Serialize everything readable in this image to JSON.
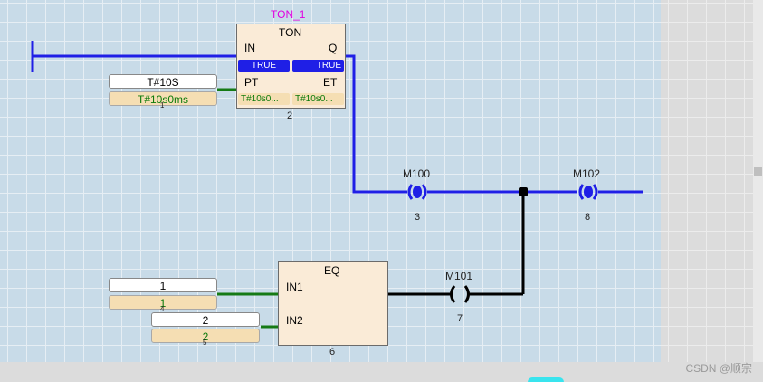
{
  "ton_block": {
    "instance_name": "TON_1",
    "type": "TON",
    "in_label": "IN",
    "q_label": "Q",
    "pt_label": "PT",
    "et_label": "ET",
    "in_value": "TRUE",
    "q_value": "TRUE",
    "pt_value": "T#10s0...",
    "et_value": "T#10s0...",
    "number": "2"
  },
  "ton_pt_input": {
    "constant": "T#10S",
    "live_value": "T#10s0ms",
    "number": "1"
  },
  "eq_block": {
    "type": "EQ",
    "in1_label": "IN1",
    "in2_label": "IN2",
    "number": "6"
  },
  "eq_in1_input": {
    "constant": "1",
    "live_value": "1",
    "number": "4"
  },
  "eq_in2_input": {
    "constant": "2",
    "live_value": "2",
    "number": "5"
  },
  "coils": [
    {
      "name": "M100",
      "number": "3",
      "state": "on",
      "color": "#1f1fe6"
    },
    {
      "name": "M102",
      "number": "8",
      "state": "on",
      "color": "#1f1fe6"
    },
    {
      "name": "M101",
      "number": "7",
      "state": "off",
      "color": "#000000"
    }
  ],
  "colors": {
    "active_wire": "#1f1fe6",
    "inactive_wire": "#000000",
    "data_wire": "#157a15",
    "block_fill": "#faebd7"
  },
  "watermark": "CSDN @顺宗"
}
